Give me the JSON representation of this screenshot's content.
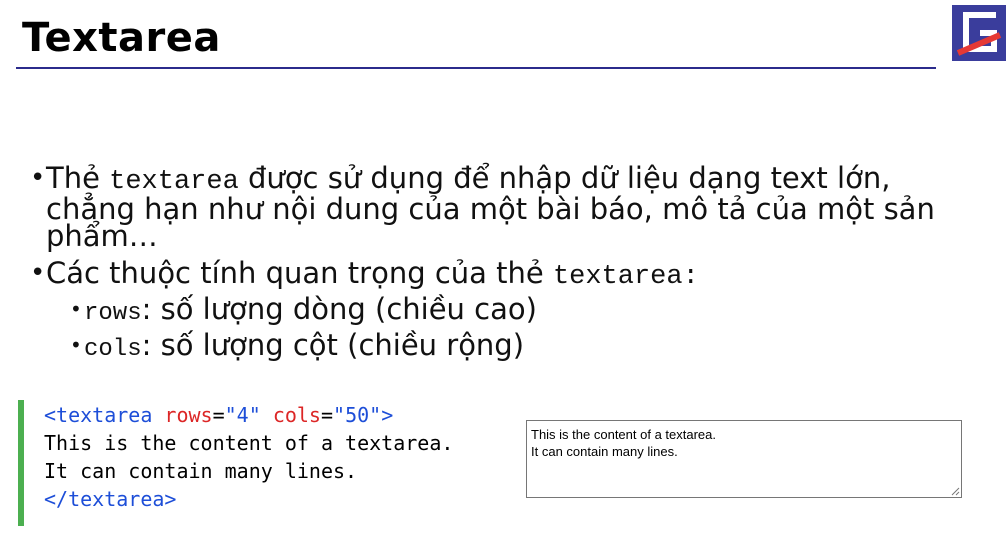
{
  "title": "Textarea",
  "bullets": {
    "b1_pre": "Thẻ ",
    "b1_code": "textarea",
    "b1_line1_post": " được sử dụng để nhập dữ liệu dạng text lớn,",
    "b1_line2": "chẳng hạn như nội dung của một bài báo, mô tả của một sản",
    "b1_line3": "phẩm…",
    "b2_pre": "Các thuộc tính quan trọng của thẻ ",
    "b2_code": "textarea:",
    "rows_code": "rows",
    "rows_text": ": số lượng dòng (chiều cao)",
    "cols_code": "cols",
    "cols_text": ": số lượng cột (chiều rộng)"
  },
  "code": {
    "open_tag": "<textarea",
    "attr_rows": "rows",
    "eq1": "=",
    "val_rows": "\"4\"",
    "attr_cols": "cols",
    "eq2": "=",
    "val_cols": "\"50\"",
    "gt": ">",
    "line2": "This is the content of a textarea.",
    "line3": "It can contain many lines.",
    "close_tag": "</textarea>"
  },
  "demo": {
    "value": "This is the content of a textarea.\nIt can contain many lines."
  },
  "colors": {
    "accent_bar": "#4caf50",
    "rule": "#2b2b8c",
    "logo_bg": "#3a3d9c",
    "logo_slash": "#e53935"
  }
}
